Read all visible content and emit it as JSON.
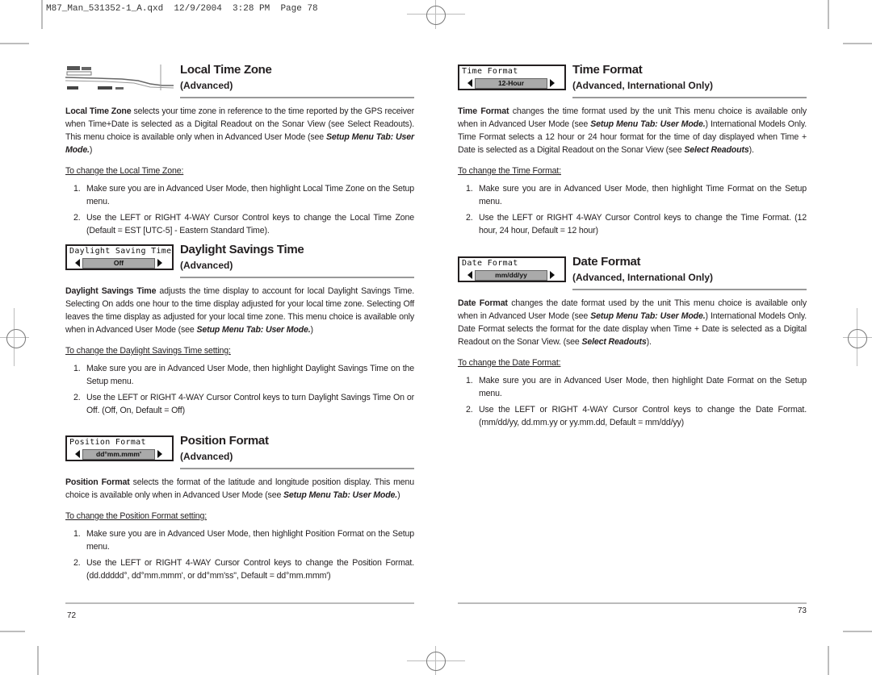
{
  "slug": "M87_Man_531352-1_A.qxd  12/9/2004  3:28 PM  Page 78",
  "left_page": {
    "page_number": "72",
    "sections": [
      {
        "id": "local-time-zone",
        "screen": {
          "type": "sonar-thumbnail",
          "icon": "sonar-view-thumbnail"
        },
        "title": "Local Time Zone",
        "subtitle": "(Advanced)",
        "body": {
          "lead": "Local Time Zone",
          "text1": " selects your time zone in reference to the time reported by the GPS receiver when Time+Date is selected as a Digital Readout on the Sonar View (see Select Readouts).  This menu choice is available only when in Advanced User Mode (see ",
          "ref": "Setup Menu Tab: User Mode.",
          "text2": ")"
        },
        "howto": "To change the Local Time Zone:",
        "steps": [
          {
            "num": "1.",
            "text": "Make sure you are in Advanced User Mode, then highlight Local Time Zone on the Setup menu."
          },
          {
            "num": "2.",
            "text": "Use the LEFT or RIGHT 4-WAY Cursor Control keys to change the Local Time Zone (Default = EST [UTC-5] - Eastern Standard Time)."
          }
        ]
      },
      {
        "id": "daylight-savings-time",
        "screen": {
          "label": "Daylight Saving Time",
          "value": "Off"
        },
        "title": "Daylight Savings Time",
        "subtitle": "(Advanced)",
        "body": {
          "lead": "Daylight Savings Time",
          "text1": " adjusts the time display to account for local Daylight Savings Time. Selecting On adds one hour to the time display adjusted for your local time zone.  Selecting Off leaves the time display as adjusted for your local time zone. This menu choice is available only when in Advanced User Mode (see ",
          "ref": "Setup Menu Tab: User Mode.",
          "text2": ")"
        },
        "howto": "To change the Daylight Savings Time setting:",
        "steps": [
          {
            "num": "1.",
            "text": "Make sure you are in Advanced User Mode, then highlight Daylight Savings Time on the Setup menu."
          },
          {
            "num": "2.",
            "text": "Use the LEFT or RIGHT 4-WAY Cursor Control keys to turn Daylight Savings Time On or Off. (Off, On, Default = Off)"
          }
        ]
      },
      {
        "id": "position-format",
        "screen": {
          "label": "Position Format",
          "value": "dd°mm.mmm'"
        },
        "title": "Position Format",
        "subtitle": "(Advanced)",
        "body": {
          "lead": "Position Format",
          "text1": " selects the format of the latitude and longitude position display.   This menu choice is available only when in Advanced User Mode (see ",
          "ref": "Setup Menu Tab: User Mode.",
          "text2": ")"
        },
        "howto": "To change the Position Format setting:",
        "steps": [
          {
            "num": "1.",
            "text": "Make sure you are in Advanced User Mode, then highlight Position Format on the Setup menu."
          },
          {
            "num": "2.",
            "text": "Use the LEFT or RIGHT 4-WAY Cursor Control keys to change the Position Format. (dd.ddddd°, dd°mm.mmm', or dd°mm'ss\", Default = dd°mm.mmm')"
          }
        ]
      }
    ]
  },
  "right_page": {
    "page_number": "73",
    "sections": [
      {
        "id": "time-format",
        "screen": {
          "label": "Time Format",
          "value": "12-Hour"
        },
        "title": "Time Format",
        "subtitle": "(Advanced, International Only)",
        "body": {
          "lead": "Time Format",
          "text1": " changes the time format used by the unit  This menu choice is available only when in Advanced User Mode (see ",
          "ref": "Setup Menu Tab: User Mode.",
          "text2": ") International Models Only. Time Format selects a 12 hour or 24 hour format for the time of day displayed when Time + Date is selected as a Digital Readout on the Sonar View (see ",
          "ref2": "Select Readouts",
          "text3": ")."
        },
        "howto": "To change the Time Format:",
        "steps": [
          {
            "num": "1.",
            "text": "Make sure you are in Advanced User Mode, then highlight Time Format on the Setup menu."
          },
          {
            "num": "2.",
            "text": "Use the LEFT or RIGHT 4-WAY Cursor Control keys to change the Time Format. (12 hour, 24 hour, Default = 12 hour)"
          }
        ]
      },
      {
        "id": "date-format",
        "screen": {
          "label": "Date Format",
          "value": "mm/dd/yy"
        },
        "title": "Date Format",
        "subtitle": "(Advanced, International Only)",
        "body": {
          "lead": "Date Format",
          "text1": " changes the date format used by the unit  This menu choice is available only when in Advanced User Mode (see ",
          "ref": "Setup Menu Tab: User Mode.",
          "text2": ")  International Models Only. Date Format selects the format for the date display when Time + Date is selected as a Digital Readout on the Sonar View. (see ",
          "ref2": "Select Readouts",
          "text3": ")."
        },
        "howto": "To change the Date Format:",
        "steps": [
          {
            "num": "1.",
            "text": "Make sure you are in Advanced User Mode, then highlight Date Format on the Setup menu."
          },
          {
            "num": "2.",
            "text": "Use the LEFT or RIGHT 4-WAY Cursor Control keys to change the Date Format. (mm/dd/yy, dd.mm.yy or yy.mm.dd, Default = mm/dd/yy)"
          }
        ]
      }
    ]
  }
}
